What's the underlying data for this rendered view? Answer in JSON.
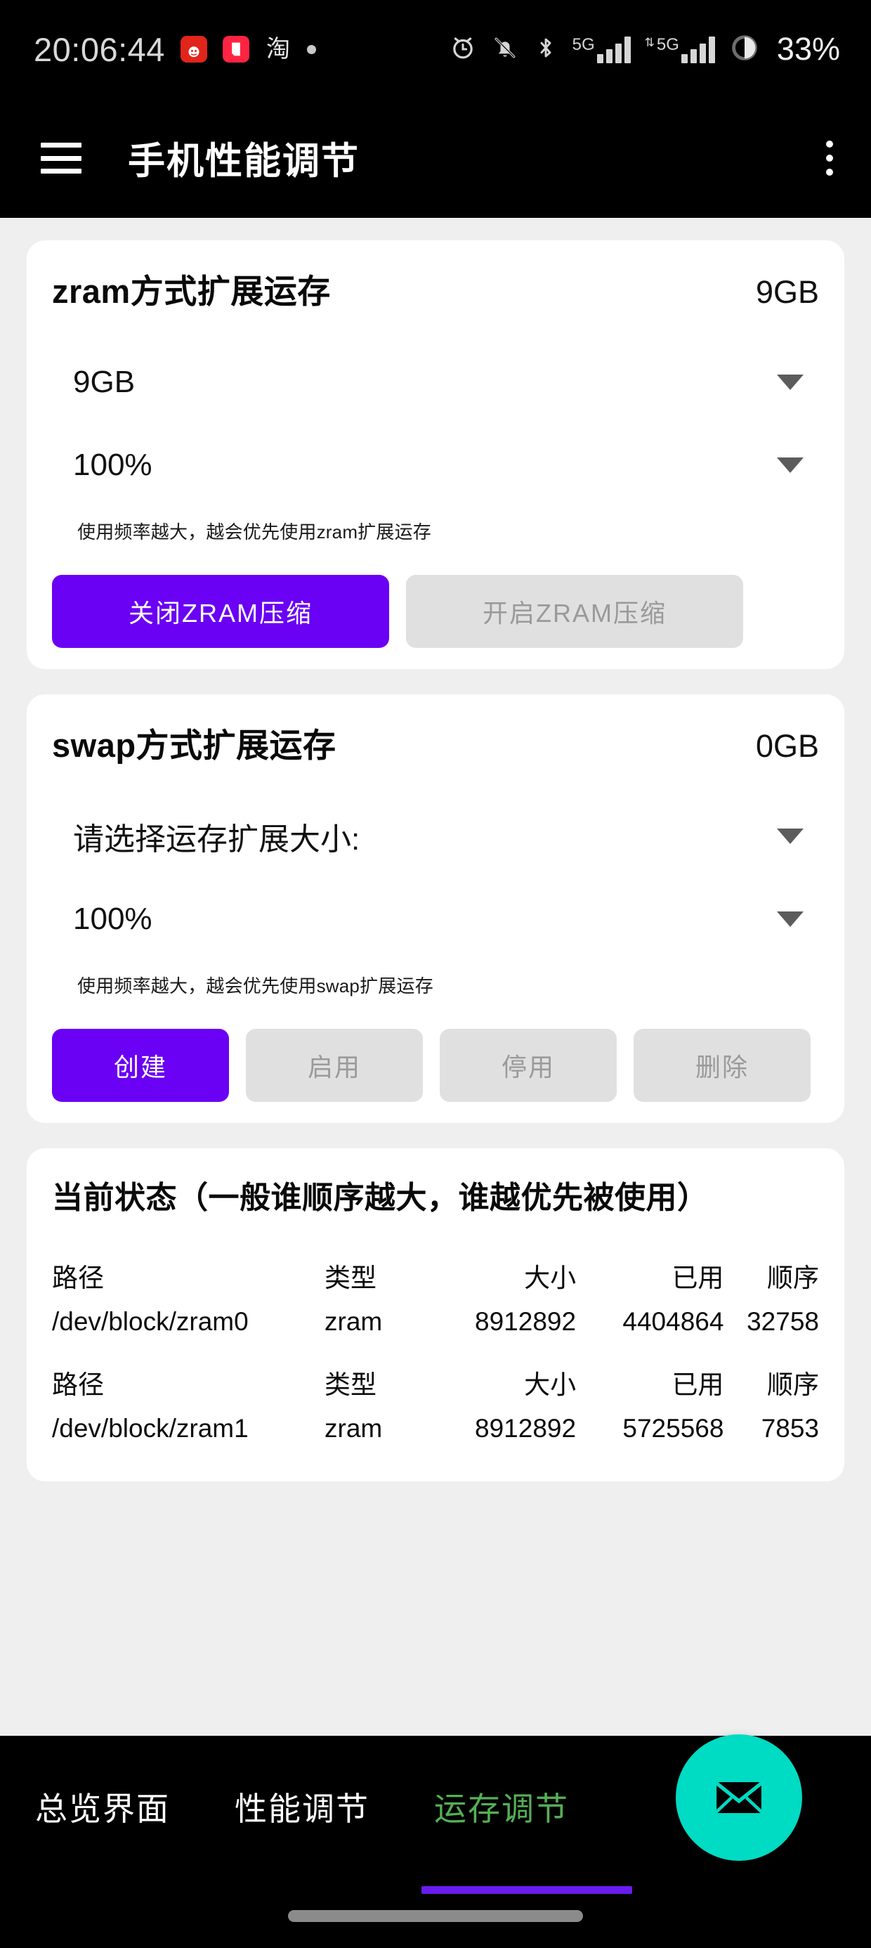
{
  "status_bar": {
    "clock": "20:06:44",
    "app_icons": [
      "jd-icon",
      "xiaohongshu-icon",
      "taobao-icon"
    ],
    "taobao_glyph": "淘",
    "notification_dot": true,
    "right_icons": [
      "alarm-icon",
      "bell-muted-icon",
      "bluetooth-icon",
      "signal-5g-icon",
      "signal-5g-secondary-icon",
      "battery-icon"
    ],
    "network_label": "5G",
    "network_label_secondary": "5G",
    "battery_percent": "33%"
  },
  "app_bar": {
    "menu_icon": "hamburger-icon",
    "title": "手机性能调节",
    "overflow_icon": "more-vertical-icon"
  },
  "cards": {
    "zram": {
      "title": "zram方式扩展运存",
      "value": "9GB",
      "size_select": {
        "value": "9GB",
        "caret": "chevron-down-icon"
      },
      "percent_select": {
        "value": "100%",
        "caret": "chevron-down-icon"
      },
      "hint": "使用频率越大，越会优先使用zram扩展运存",
      "buttons": [
        {
          "label": "关闭ZRAM压缩",
          "state": "enabled"
        },
        {
          "label": "开启ZRAM压缩",
          "state": "disabled"
        }
      ]
    },
    "swap": {
      "title": "swap方式扩展运存",
      "value": "0GB",
      "size_select": {
        "value": "请选择运存扩展大小:",
        "caret": "chevron-down-icon"
      },
      "percent_select": {
        "value": "100%",
        "caret": "chevron-down-icon"
      },
      "hint": "使用频率越大，越会优先使用swap扩展运存",
      "buttons": [
        {
          "label": "创建",
          "state": "enabled"
        },
        {
          "label": "启用",
          "state": "disabled"
        },
        {
          "label": "停用",
          "state": "disabled"
        },
        {
          "label": "删除",
          "state": "disabled"
        }
      ]
    },
    "status": {
      "title": "当前状态（一般谁顺序越大，谁越优先被使用）",
      "columns": [
        "路径",
        "类型",
        "大小",
        "已用",
        "顺序"
      ],
      "rows": [
        {
          "path": "/dev/block/zram0",
          "type": "zram",
          "size": "8912892",
          "used": "4404864",
          "order": "32758"
        },
        {
          "path": "/dev/block/zram1",
          "type": "zram",
          "size": "8912892",
          "used": "5725568",
          "order": "7853"
        }
      ]
    }
  },
  "fab": {
    "icon": "envelope-icon"
  },
  "bottom_nav": {
    "tabs": [
      {
        "label": "总览界面",
        "active": false
      },
      {
        "label": "性能调节",
        "active": false
      },
      {
        "label": "运存调节",
        "active": true
      }
    ]
  },
  "colors": {
    "accent_purple": "#6a00f4",
    "fab_teal": "#00dbc3",
    "active_tab_green": "#55b055",
    "indicator_purple": "#6a1bf0",
    "page_background": "#efefef",
    "card_background": "#ffffff",
    "disabled_button": "#e0e0e0"
  }
}
